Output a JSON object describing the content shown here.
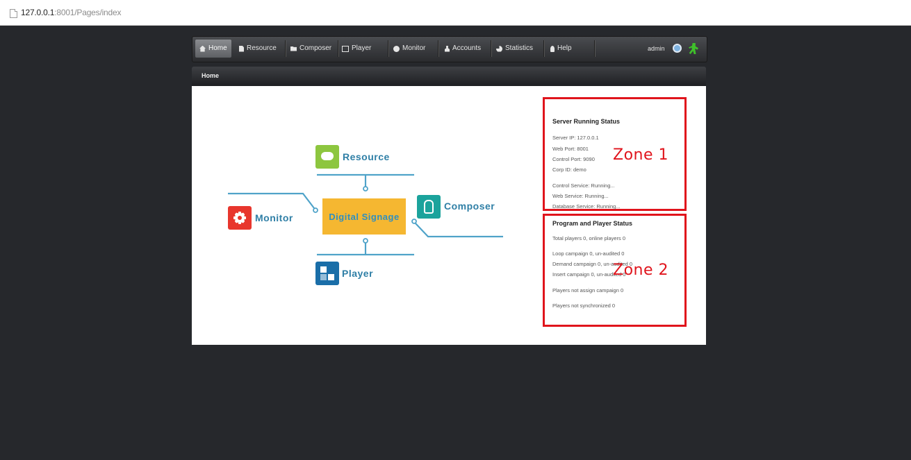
{
  "address_bar": {
    "host": "127.0.0.1",
    "rest": ":8001/Pages/index"
  },
  "nav": {
    "items": [
      {
        "label": "Home",
        "icon": "home-icon",
        "active": true
      },
      {
        "label": "Resource",
        "icon": "document-icon"
      },
      {
        "label": "Composer",
        "icon": "folder-icon"
      },
      {
        "label": "Player",
        "icon": "monitor-screen-icon"
      },
      {
        "label": "Monitor",
        "icon": "record-icon"
      },
      {
        "label": "Accounts",
        "icon": "user-icon"
      },
      {
        "label": "Statistics",
        "icon": "pie-chart-icon"
      },
      {
        "label": "Help",
        "icon": "lightbulb-icon"
      }
    ],
    "user": "admin"
  },
  "breadcrumb": "Home",
  "diagram": {
    "center": "Digital Signage",
    "nodes": {
      "resource": "Resource",
      "monitor": "Monitor",
      "composer": "Composer",
      "player": "Player"
    }
  },
  "zone1": {
    "title": "Server Running Status",
    "lines": [
      "Server IP: 127.0.0.1",
      "Web Port: 8001",
      "Control Port: 9090",
      "Corp ID: demo",
      "Control Service: Running...",
      "Web Service: Running...",
      "Database Service: Running..."
    ],
    "annotation": "Zone 1"
  },
  "zone2": {
    "title": "Program and Player Status",
    "lines": [
      "Total players 0, online players 0",
      "Loop campaign 0, un-audited 0",
      "Demand campaign 0, un-audited 0",
      "Insert campaign 0, un-audited 0",
      "Players not assign campaign 0",
      "Players not synchronized 0"
    ],
    "annotation": "Zone 2"
  },
  "colors": {
    "background": "#26282c",
    "resource": "#8dc63f",
    "monitor": "#e8362d",
    "composer": "#1ba39c",
    "player": "#1a6ea8",
    "center": "#f5b731",
    "zone_border": "#e0141c",
    "link": "#2f7fa6"
  }
}
